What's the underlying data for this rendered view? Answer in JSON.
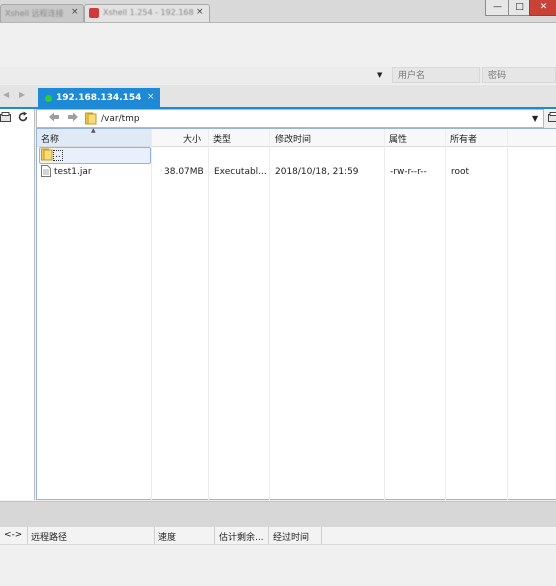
{
  "titlebar": {
    "tabs": [
      {
        "label": "Xshell 远程连接"
      },
      {
        "label": "Xshell 1.254 - 192.168"
      }
    ],
    "window_buttons": {
      "minimize": "—",
      "restore": "□",
      "close": "✕"
    }
  },
  "login": {
    "username_placeholder": "用户名",
    "password_placeholder": "密码"
  },
  "session_tab": {
    "label": "192.168.134.154",
    "close": "×",
    "status_color": "#2ccc3c"
  },
  "nav": {
    "back": "◀",
    "forward": "▶",
    "left": "◀",
    "right": "▶"
  },
  "path": {
    "value": "/var/tmp",
    "dropdown": "▼"
  },
  "file_table": {
    "columns": [
      "名称",
      "大小",
      "类型",
      "修改时间",
      "属性",
      "所有者"
    ],
    "rows": [
      {
        "name": "..",
        "size": "",
        "type": "",
        "modified": "",
        "attributes": "",
        "owner": "",
        "icon": "folder-up-icon"
      },
      {
        "name": "test1.jar",
        "size": "38.07MB",
        "type": "Executabl...",
        "modified": "2018/10/18, 21:59",
        "attributes": "-rw-r--r--",
        "owner": "root",
        "icon": "file-icon"
      }
    ]
  },
  "transfer": {
    "columns": [
      "<->",
      "远程路径",
      "速度",
      "估计剩余...",
      "经过时间"
    ]
  },
  "colors": {
    "accent": "#1e8ad6",
    "selection": "#e8f1fb",
    "close": "#c94238"
  }
}
